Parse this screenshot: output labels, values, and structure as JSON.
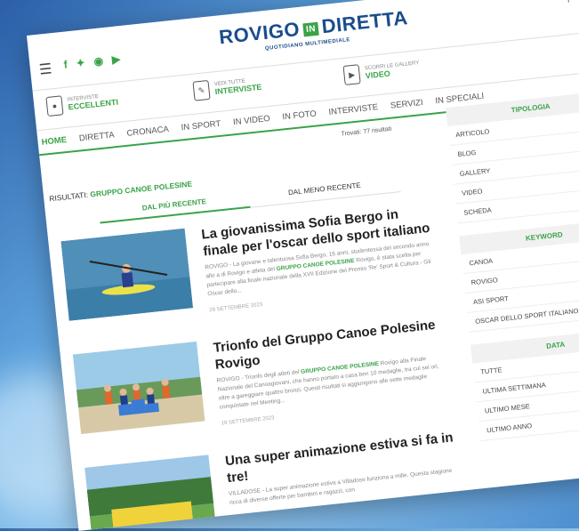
{
  "header": {
    "logo_left": "ROVIGO",
    "logo_in": "IN",
    "logo_right": "DIRETTA",
    "tagline": "QUOTIDIANO MULTIMEDIALE"
  },
  "promos": [
    {
      "small": "INTERVISTE",
      "big": "ECCELLENTI"
    },
    {
      "small": "VEDI TUTTE",
      "big": "INTERVISTE"
    },
    {
      "small": "SCORRI LE GALLERY",
      "big": "VIDEO"
    }
  ],
  "nav": [
    "HOME",
    "DIRETTA",
    "CRONACA",
    "IN SPORT",
    "IN VIDEO",
    "IN FOTO",
    "INTERVISTE",
    "SERVIZI",
    "IN SPECIALI"
  ],
  "results": {
    "trovati": "Trovati: 77 risultati",
    "label": "RISULTATI:",
    "query": "GRUPPO CANOE POLESINE",
    "sort_recent": "DAL PIÙ RECENTE",
    "sort_old": "DAL MENO RECENTE"
  },
  "articles": [
    {
      "title": "La giovanissima Sofia Bergo in finale per l'oscar dello sport italiano",
      "excerpt_pre": "ROVIGO - La giovane e talentuosa Sofia Bergo, 16 anni, studentessa del secondo anno allo a di Rovigo e atleta del",
      "excerpt_hl": "GRUPPO CANOE POLESINE",
      "excerpt_post": "Rovigo, è stata scelta per partecipare alla finale nazionale della XVII Edizione del Premio 'Re' Sport & Cultura - Gli Oscar dello...",
      "date": "28 SETTEMBRE 2023"
    },
    {
      "title": "Trionfo del Gruppo Canoe Polesine Rovigo",
      "excerpt_pre": "ROVIGO - Trionfo degli atleti del",
      "excerpt_hl": "GRUPPO CANOE POLESINE",
      "excerpt_post": "Rovigo alla Finale Nazionale del Canoagiovani, che hanno portato a casa ben 10 medaglie, tra cui sei ori, oltre a gareggiare quattro bronzi. Questi risultati si aggiungono alle sette medaglie conquistate nel Meeting...",
      "date": "18 SETTEMBRE 2023"
    },
    {
      "title": "Una super animazione estiva si fa in tre!",
      "excerpt_pre": "VILLADOSE - La super animazione estiva a Villadose funziona a mille. Questa stagione ricca di diverse offerte per bambini e ragazzi, con",
      "excerpt_hl": "",
      "excerpt_post": "",
      "date": ""
    }
  ],
  "sidebar": [
    {
      "head": "TIPOLOGIA",
      "items": [
        "ARTICOLO",
        "BLOG",
        "GALLERY",
        "VIDEO",
        "SCHEDA"
      ]
    },
    {
      "head": "KEYWORD",
      "items": [
        "CANOA",
        "ROVIGO",
        "ASI SPORT",
        "OSCAR DELLO SPORT ITALIANO"
      ]
    },
    {
      "head": "DATA",
      "items": [
        "TUTTE",
        "ULTIMA SETTIMANA",
        "ULTIMO MESE",
        "ULTIMO ANNO"
      ]
    }
  ],
  "colors": {
    "accent": "#3aa348",
    "brand": "#1a4c8c"
  }
}
